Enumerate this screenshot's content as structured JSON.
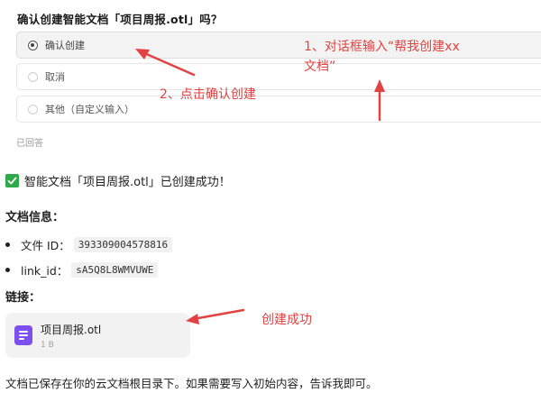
{
  "question": {
    "title": "确认创建智能文档「项目周报.otl」吗？"
  },
  "options": [
    {
      "label": "确认创建",
      "selected": true
    },
    {
      "label": "取消",
      "selected": false
    },
    {
      "label": "其他（自定义输入）",
      "selected": false
    }
  ],
  "answered_label": "已回答",
  "success_message": "智能文档「项目周报.otl」已创建成功！",
  "doc_info": {
    "title": "文档信息：",
    "items": [
      {
        "label": "文件 ID：",
        "value": "393309004578816"
      },
      {
        "label": "link_id：",
        "value": "sA5Q8L8WMVUWE"
      }
    ]
  },
  "link": {
    "title": "链接：",
    "name": "项目周报.otl",
    "size": "1 B"
  },
  "footer": "文档已保存在你的云文档根目录下。如果需要写入初始内容，告诉我即可。",
  "annotations": {
    "dialog_input_line1": "1、对话框输入“帮我创建xx",
    "dialog_input_line2": "文档”",
    "click_confirm": "2、点击确认创建",
    "created": "创建成功"
  },
  "colors": {
    "annotation": "#e34242",
    "doc_icon": "#7b4ff0",
    "success_check": "#2eaa4a"
  }
}
